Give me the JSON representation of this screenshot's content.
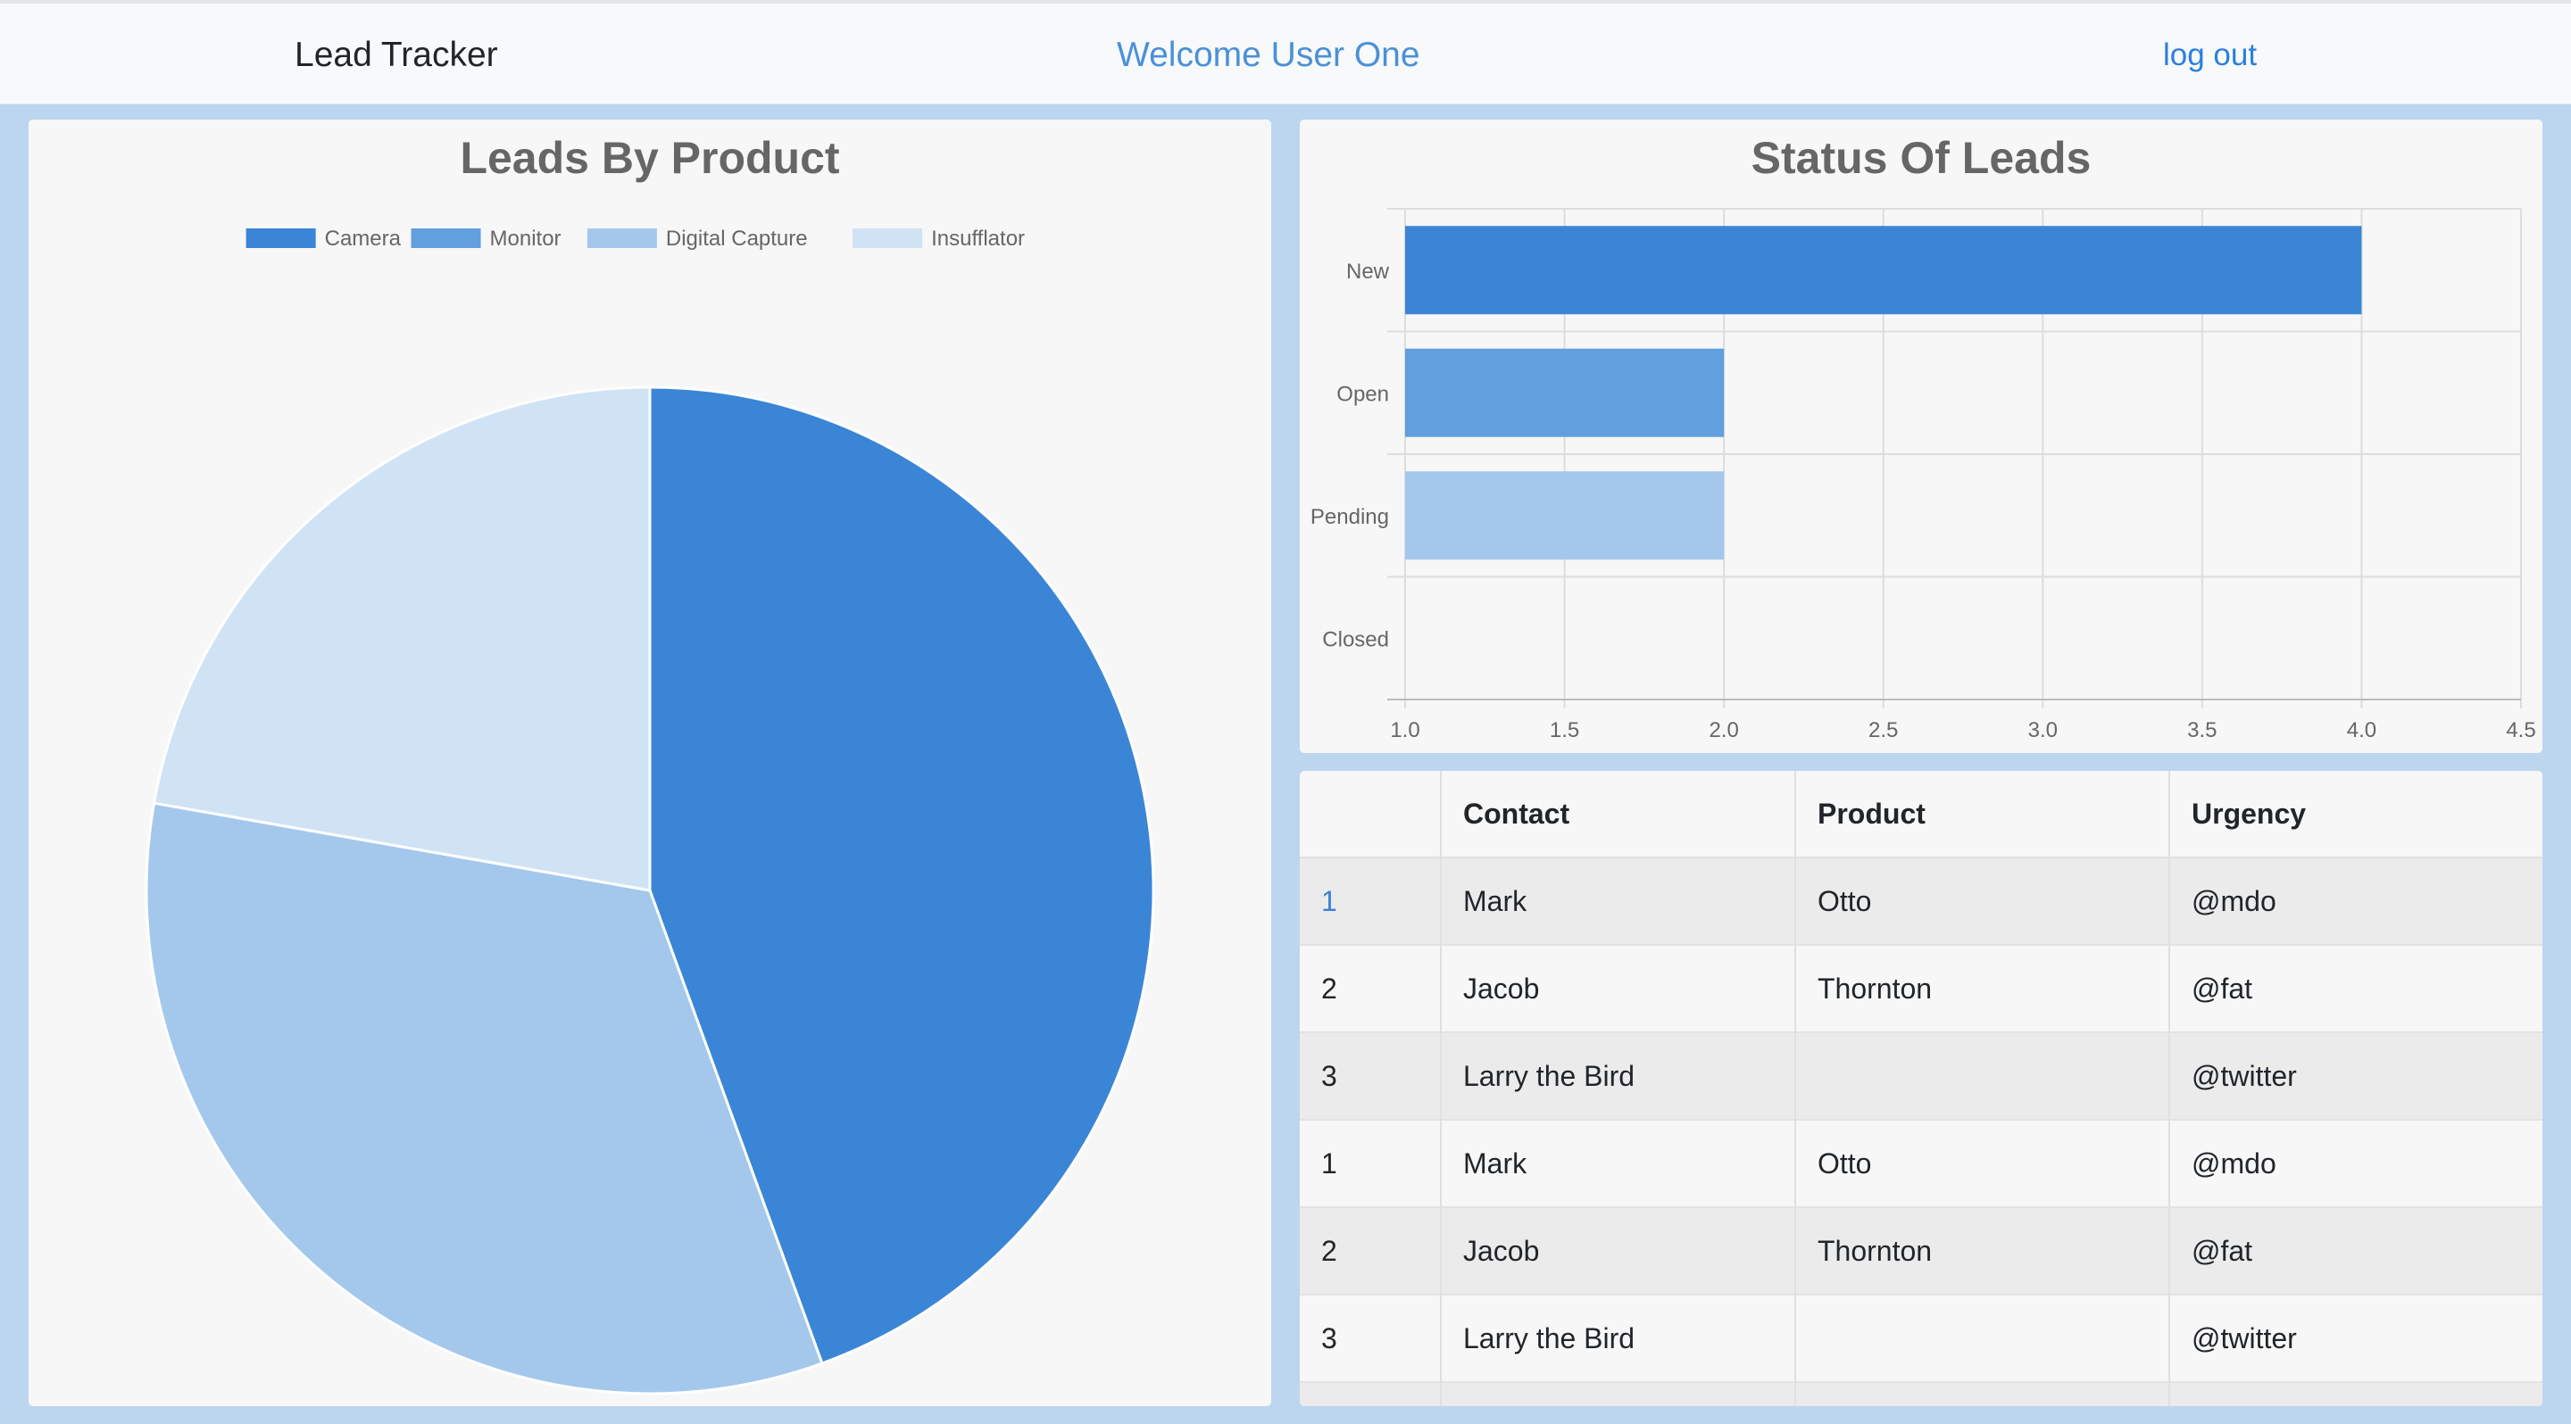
{
  "navbar": {
    "brand": "Lead Tracker",
    "welcome": "Welcome User One",
    "logout": "log out"
  },
  "colors": {
    "camera": "#3b85d7",
    "monitor": "#619fde",
    "digital_capture": "#a4c8ec",
    "insufflator": "#d0e3f5",
    "background": "#bcd6f0",
    "panel": "#f7f7f7"
  },
  "chart_data": [
    {
      "type": "pie",
      "title": "Leads By Product",
      "legend_position": "top",
      "labels": [
        "Camera",
        "Monitor",
        "Digital Capture",
        "Insufflator"
      ],
      "values": [
        4,
        0,
        3,
        2
      ],
      "colors": [
        "#3b85d7",
        "#619fde",
        "#a4c8ec",
        "#d0e3f5"
      ]
    },
    {
      "type": "bar",
      "orientation": "horizontal",
      "title": "Status Of Leads",
      "categories": [
        "New",
        "Open",
        "Pending",
        "Closed"
      ],
      "values": [
        4,
        2,
        2,
        null
      ],
      "colors": [
        "#3b85d7",
        "#619fde",
        "#a4c8ec",
        "#d0e3f5"
      ],
      "xlim": [
        1,
        4.5
      ],
      "x_ticks": [
        "1.0",
        "1.5",
        "2.0",
        "2.5",
        "3.0",
        "3.5",
        "4.0",
        "4.5"
      ],
      "grid": true
    }
  ],
  "table": {
    "headers": [
      "",
      "Contact",
      "Product",
      "Urgency"
    ],
    "rows": [
      {
        "num": "1",
        "contact": "Mark",
        "product": "Otto",
        "urgency": "@mdo"
      },
      {
        "num": "2",
        "contact": "Jacob",
        "product": "Thornton",
        "urgency": "@fat"
      },
      {
        "num": "3",
        "contact": "Larry the Bird",
        "product": "",
        "urgency": "@twitter"
      },
      {
        "num": "1",
        "contact": "Mark",
        "product": "Otto",
        "urgency": "@mdo"
      },
      {
        "num": "2",
        "contact": "Jacob",
        "product": "Thornton",
        "urgency": "@fat"
      },
      {
        "num": "3",
        "contact": "Larry the Bird",
        "product": "",
        "urgency": "@twitter"
      }
    ]
  }
}
